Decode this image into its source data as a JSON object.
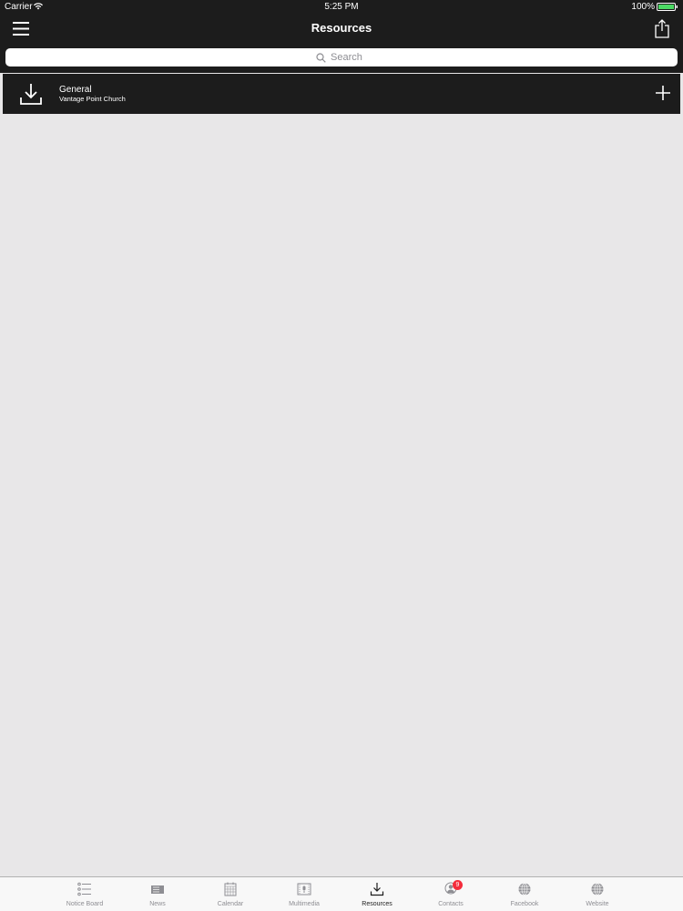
{
  "status_bar": {
    "carrier": "Carrier",
    "time": "5:25 PM",
    "battery": "100%"
  },
  "nav": {
    "title": "Resources"
  },
  "search": {
    "placeholder": "Search"
  },
  "resources": [
    {
      "title": "General",
      "subtitle": "Vantage Point Church",
      "icon": "download-icon",
      "action_icon": "plus-icon"
    }
  ],
  "tabs": [
    {
      "label": "Notice Board",
      "icon": "list-icon",
      "active": false
    },
    {
      "label": "News",
      "icon": "news-icon",
      "active": false
    },
    {
      "label": "Calendar",
      "icon": "calendar-icon",
      "active": false
    },
    {
      "label": "Multimedia",
      "icon": "multimedia-icon",
      "active": false
    },
    {
      "label": "Resources",
      "icon": "download-icon",
      "active": true
    },
    {
      "label": "Contacts",
      "icon": "contacts-icon",
      "active": false,
      "badge": "9"
    },
    {
      "label": "Facebook",
      "icon": "globe-icon",
      "active": false
    },
    {
      "label": "Website",
      "icon": "globe-icon",
      "active": false
    }
  ],
  "colors": {
    "bar_background": "#1c1c1c",
    "page_background": "#e8e7e8",
    "tab_bar_background": "#f8f8f8",
    "badge": "#f42c3b",
    "battery_fill": "#4cd964"
  }
}
